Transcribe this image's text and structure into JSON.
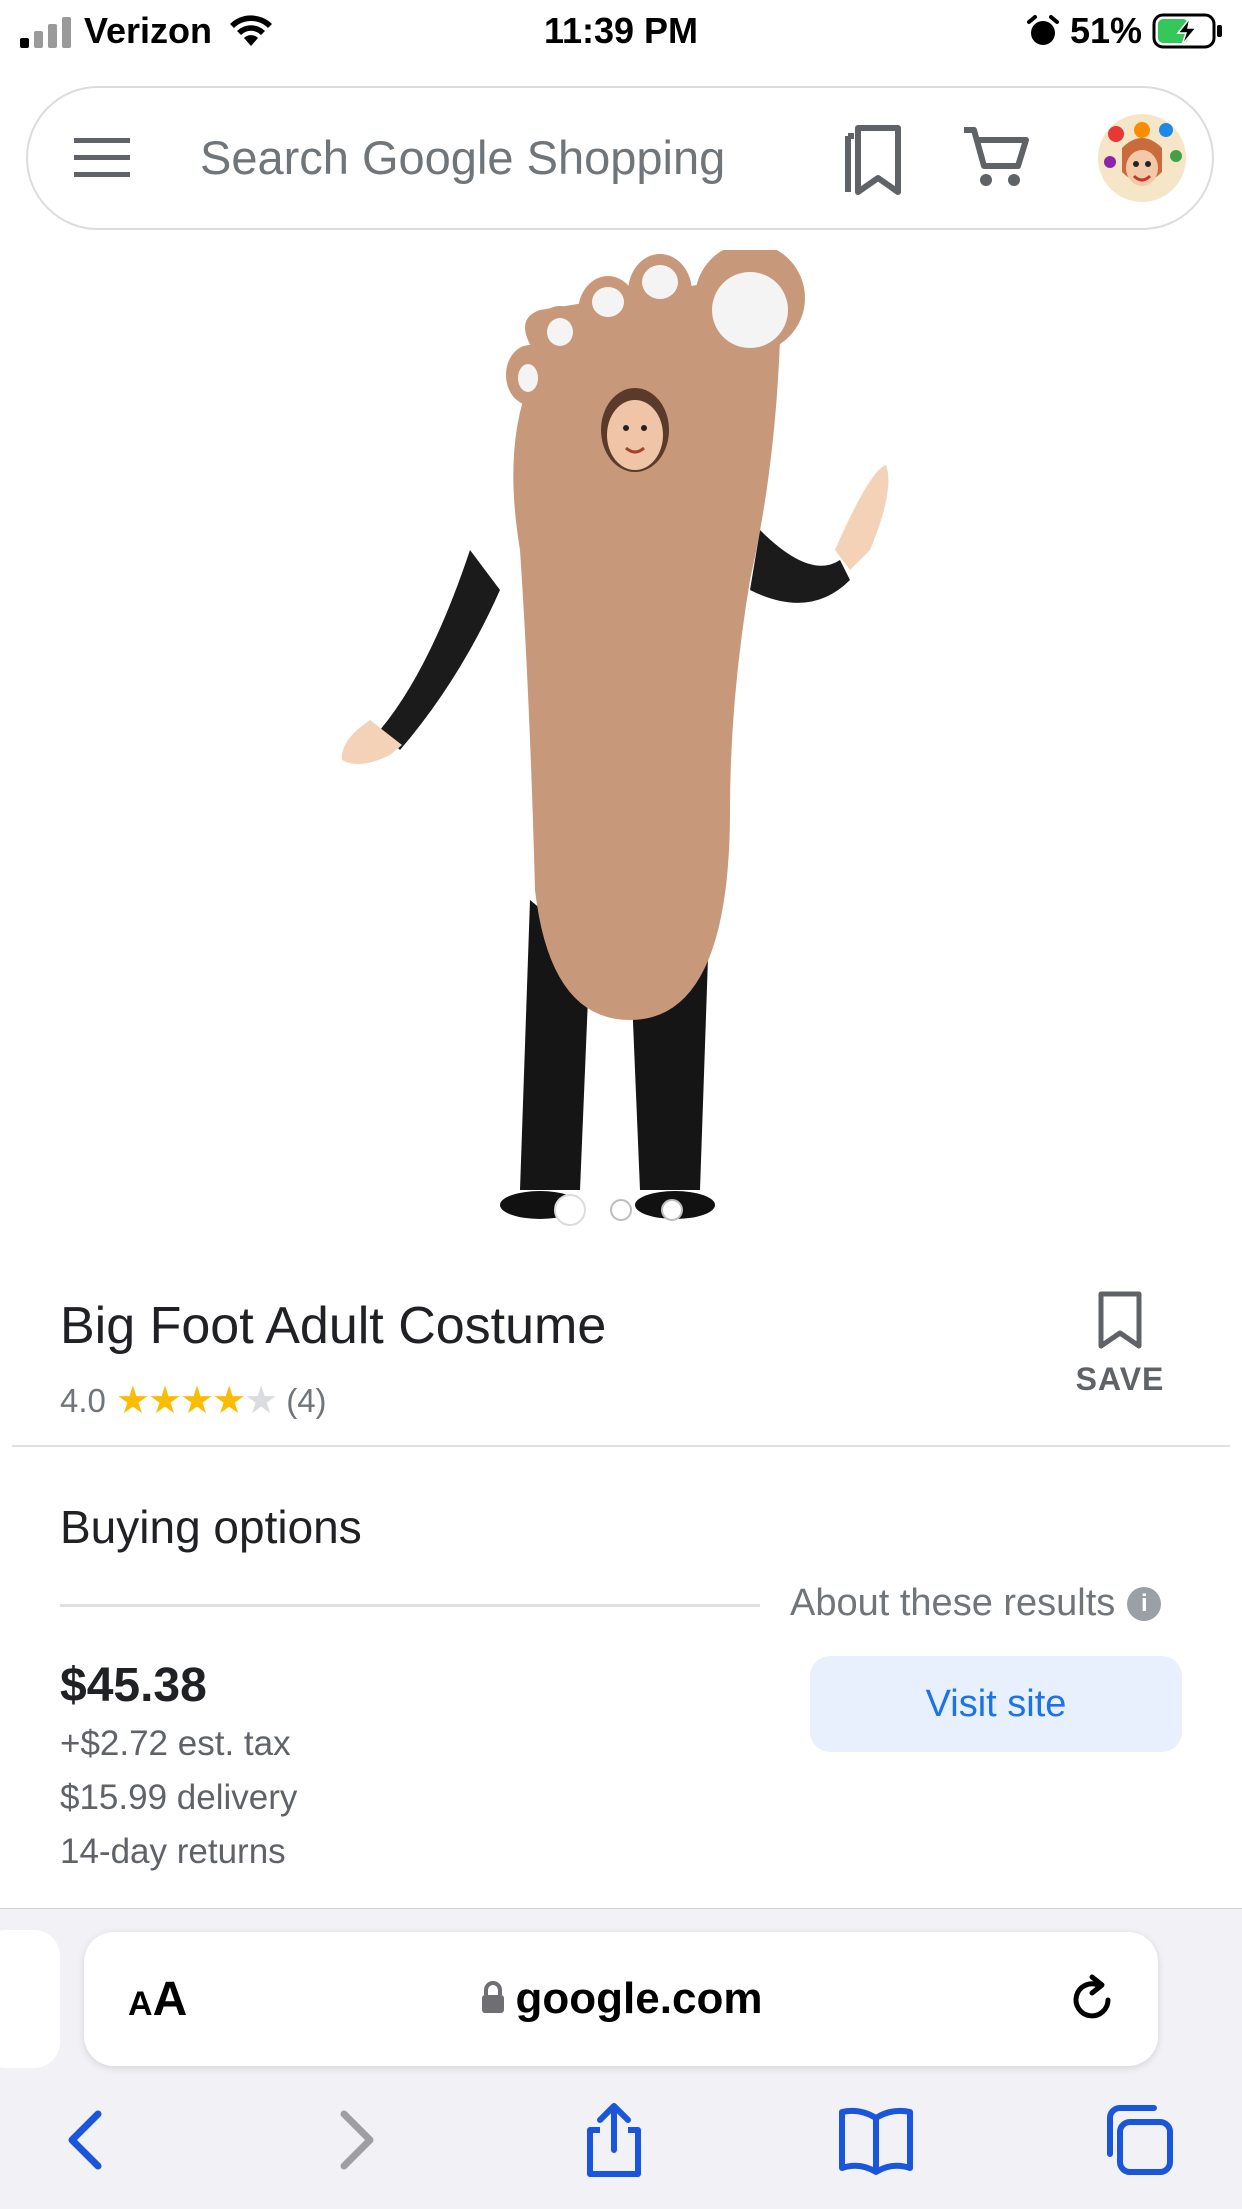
{
  "status_bar": {
    "carrier": "Verizon",
    "time": "11:39 PM",
    "battery": "51%"
  },
  "search": {
    "placeholder": "Search Google Shopping"
  },
  "carousel": {
    "total": 3,
    "active_index": 0
  },
  "product": {
    "title": "Big Foot Adult Costume",
    "rating_value": "4.0",
    "rating_stars": 4,
    "rating_count": "(4)",
    "save_label": "SAVE"
  },
  "buying_options": {
    "heading": "Buying options",
    "about_label": "About these results",
    "info_icon_text": "i",
    "price": "$45.38",
    "tax": "+$2.72 est. tax",
    "delivery": "$15.99 delivery",
    "returns": "14-day returns",
    "visit_label": "Visit site"
  },
  "browser": {
    "text_size_label_small": "A",
    "text_size_label_large": "A",
    "domain": "google.com"
  },
  "colors": {
    "accent_blue": "#1a73e8",
    "star_gold": "#fbbc04",
    "safari_blue": "#1a56db"
  }
}
